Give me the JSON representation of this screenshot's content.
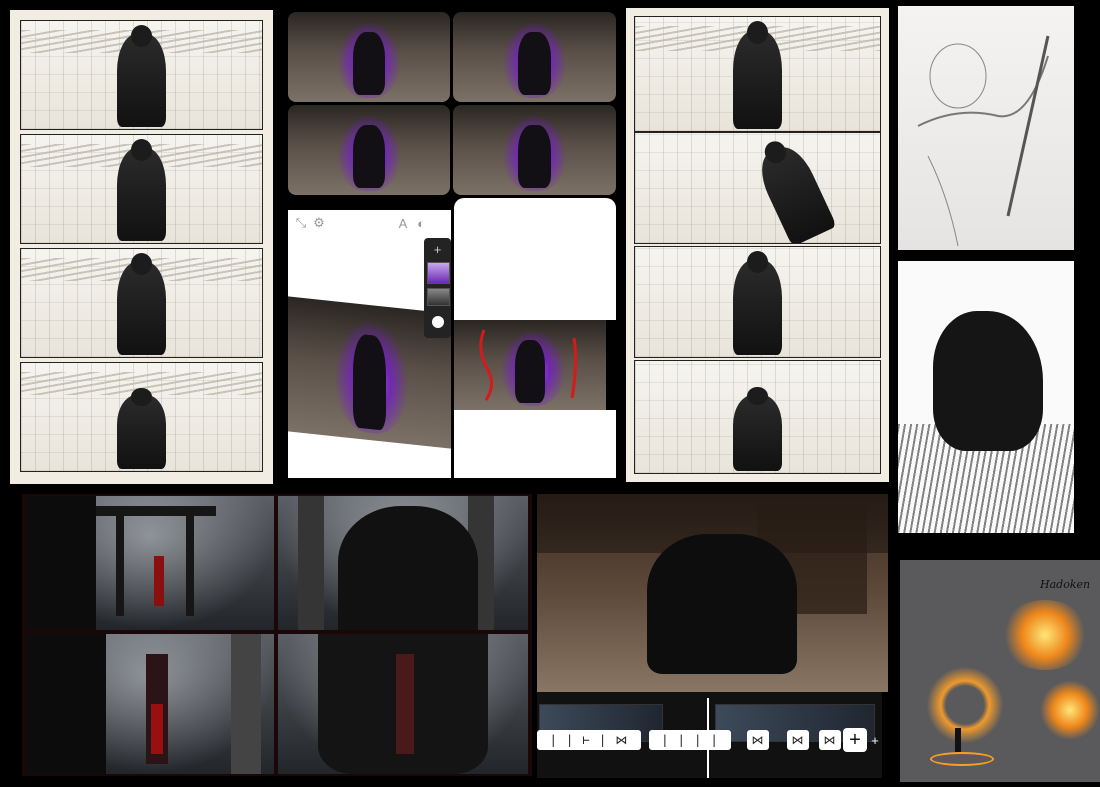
{
  "canvas": {
    "background": "#000000"
  },
  "colors": {
    "paper": "#f1ede3",
    "purple_aura": "#a63cf0",
    "fire": "#ff9b1f",
    "timeline_bg": "#111111",
    "playhead": "#ffffff"
  },
  "toolbar_icons": [
    "plus-icon",
    "image-thumb-purple",
    "image-thumb-street",
    "circle-icon"
  ],
  "top_bar_icons": [
    "select-icon",
    "settings-icon",
    "text-icon",
    "color-icon",
    "close-icon"
  ],
  "timeline": {
    "chip_labels": [
      "| | ⊢ | ⋈",
      "| | |  |",
      "⋈",
      "⋈",
      "⋈"
    ],
    "add_symbol": "+",
    "extra_symbol": "+"
  },
  "annotation": {
    "text": "Hadoken"
  }
}
